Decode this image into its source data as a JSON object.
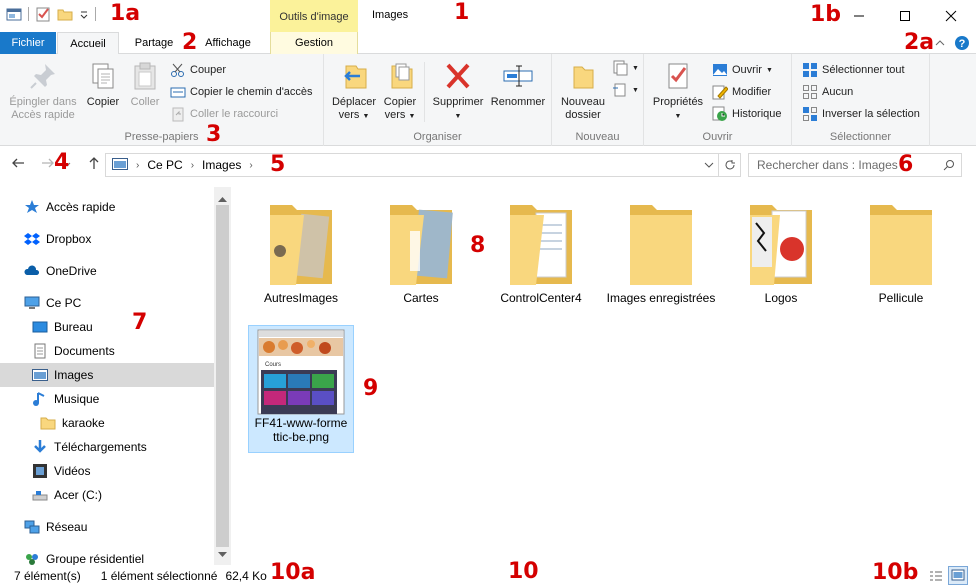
{
  "window": {
    "contextual_tab": "Outils d'image",
    "title": "Images",
    "controls": [
      "minimize-icon",
      "maximize-icon",
      "close-icon"
    ]
  },
  "tabs": {
    "file": "Fichier",
    "home": "Accueil",
    "share": "Partage",
    "view": "Affichage",
    "manage": "Gestion"
  },
  "ribbon": {
    "clipboard": {
      "label": "Presse-papiers",
      "pin_line1": "Épingler dans",
      "pin_line2": "Accès rapide",
      "copy": "Copier",
      "paste": "Coller",
      "cut": "Couper",
      "copy_path": "Copier le chemin d'accès",
      "paste_shortcut": "Coller le raccourci"
    },
    "organize": {
      "label": "Organiser",
      "move_line1": "Déplacer",
      "move_line2": "vers",
      "copyto_line1": "Copier",
      "copyto_line2": "vers",
      "delete": "Supprimer",
      "rename": "Renommer"
    },
    "new": {
      "label": "Nouveau",
      "folder_line1": "Nouveau",
      "folder_line2": "dossier"
    },
    "open": {
      "label": "Ouvrir",
      "properties": "Propriétés",
      "open": "Ouvrir",
      "edit": "Modifier",
      "history": "Historique"
    },
    "select": {
      "label": "Sélectionner",
      "select_all": "Sélectionner tout",
      "select_none": "Aucun",
      "invert": "Inverser la sélection"
    }
  },
  "address": {
    "crumb_1": "Ce PC",
    "crumb_2": "Images",
    "search_placeholder": "Rechercher dans : Images"
  },
  "sidebar": {
    "items": [
      {
        "label": "Accès rapide"
      },
      {
        "label": "Dropbox"
      },
      {
        "label": "OneDrive"
      },
      {
        "label": "Ce PC"
      },
      {
        "label": "Bureau"
      },
      {
        "label": "Documents"
      },
      {
        "label": "Images"
      },
      {
        "label": "Musique"
      },
      {
        "label": "karaoke"
      },
      {
        "label": "Téléchargements"
      },
      {
        "label": "Vidéos"
      },
      {
        "label": "Acer (C:)"
      },
      {
        "label": "Réseau"
      },
      {
        "label": "Groupe résidentiel"
      }
    ],
    "selected": "Images"
  },
  "content": {
    "items": [
      {
        "name": "AutresImages"
      },
      {
        "name": "Cartes"
      },
      {
        "name": "ControlCenter4"
      },
      {
        "name": "Images enregistrées"
      },
      {
        "name": "Logos"
      },
      {
        "name": "Pellicule"
      },
      {
        "name": "FF41-www-formettic-be.png",
        "line1": "FF41-www-forme",
        "line2": "ttic-be.png",
        "selected": true
      }
    ],
    "thumb_heading": "Cours"
  },
  "status": {
    "count": "7 élément(s)",
    "selection": "1 élément sélectionné",
    "size": "62,4 Ko"
  },
  "annotations": {
    "a1": "1",
    "a1a": "1a",
    "a1b": "1b",
    "a2": "2",
    "a2a": "2a",
    "a3": "3",
    "a4": "4",
    "a5": "5",
    "a6": "6",
    "a7": "7",
    "a8": "8",
    "a9": "9",
    "a10": "10",
    "a10a": "10a",
    "a10b": "10b"
  },
  "colors": {
    "file_tab": "#1979ca",
    "contextual": "#fbf29a",
    "folder": "#f9d77e",
    "selection": "#cce8ff",
    "annotation": "#d40000"
  }
}
